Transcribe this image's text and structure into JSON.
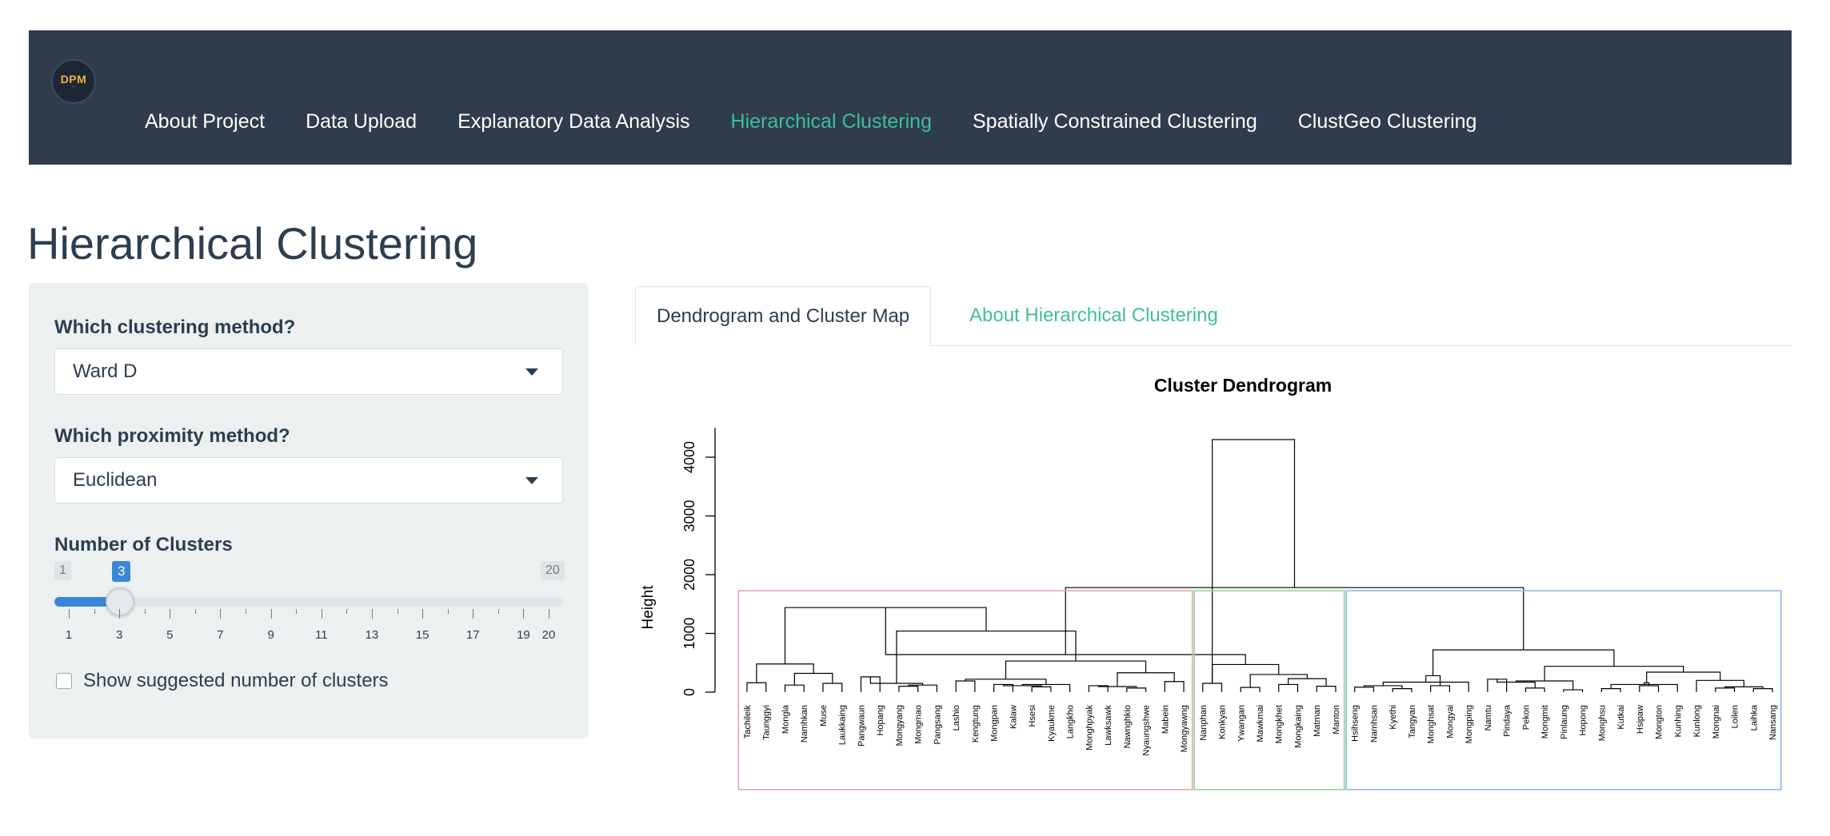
{
  "logo": {
    "text": "DPM"
  },
  "nav": {
    "items": [
      {
        "label": "About Project",
        "active": false
      },
      {
        "label": "Data Upload",
        "active": false
      },
      {
        "label": "Explanatory Data Analysis",
        "active": false
      },
      {
        "label": "Hierarchical Clustering",
        "active": true
      },
      {
        "label": "Spatially Constrained Clustering",
        "active": false
      },
      {
        "label": "ClustGeo Clustering",
        "active": false
      }
    ]
  },
  "page": {
    "title": "Hierarchical Clustering"
  },
  "sidebar": {
    "clustering_method": {
      "label": "Which clustering method?",
      "value": "Ward D"
    },
    "proximity_method": {
      "label": "Which proximity method?",
      "value": "Euclidean"
    },
    "clusters": {
      "label": "Number of Clusters",
      "min": 1,
      "max": 20,
      "value": 3,
      "min_label": "1",
      "max_label": "20",
      "value_label": "3",
      "tick_labels": [
        "1",
        "3",
        "5",
        "7",
        "9",
        "11",
        "13",
        "15",
        "17",
        "19",
        "20"
      ]
    },
    "suggest": {
      "label": "Show suggested number of clusters",
      "checked": false
    }
  },
  "tabs": [
    {
      "label": "Dendrogram and Cluster Map",
      "active": true
    },
    {
      "label": "About Hierarchical Clustering",
      "active": false
    }
  ],
  "colors": {
    "navbar": "#2f3c4d",
    "accent": "#3fbf99",
    "slider": "#3a87d6",
    "cluster_1": "#e8a3ad",
    "cluster_2": "#8fd68f",
    "cluster_3": "#8ab8e6"
  },
  "chart_data": {
    "type": "dendrogram",
    "title": "Cluster Dendrogram",
    "ylabel": "Height",
    "yticks": [
      0,
      1000,
      2000,
      3000,
      4000
    ],
    "ylim": [
      0,
      4300
    ],
    "leaves": [
      "Tachileik",
      "Taunggyi",
      "Mongla",
      "Namhkan",
      "Muse",
      "Laukkaing",
      "Pangwaun",
      "Hopang",
      "Mongyang",
      "Mongmao",
      "Pangsang",
      "Lashio",
      "Kengtung",
      "Mongpan",
      "Kalaw",
      "Hsesi",
      "Kyaukme",
      "Langkho",
      "Monghpyak",
      "Lawksawk",
      "Nawnghkio",
      "Nyaungshwe",
      "Mabein",
      "Mongyawng",
      "Nanphan",
      "Konkyan",
      "Ywangan",
      "Mawkmai",
      "Mongkhet",
      "Mongkaing",
      "Matman",
      "Manton",
      "Hsihseng",
      "Namhsan",
      "Kyethi",
      "Tangyan",
      "Monghsat",
      "Mongyai",
      "Mongping",
      "Namtu",
      "Pindaya",
      "Pekon",
      "Mongmit",
      "Pinlaung",
      "Hopong",
      "Monghsu",
      "Kutkai",
      "Hsipaw",
      "Mongton",
      "Kunhing",
      "Kunlong",
      "Mongnai",
      "Loilen",
      "Laihka",
      "Nansang"
    ],
    "merges": [
      [
        -1,
        -2,
        160
      ],
      [
        -3,
        -4,
        120
      ],
      [
        -5,
        -6,
        150
      ],
      [
        2,
        3,
        320
      ],
      [
        1,
        4,
        480
      ],
      [
        -7,
        -8,
        260
      ],
      [
        -9,
        -10,
        100
      ],
      [
        -11,
        7,
        120
      ],
      [
        6,
        8,
        150
      ],
      [
        -12,
        -13,
        190
      ],
      [
        -14,
        -15,
        130
      ],
      [
        -16,
        -17,
        90
      ],
      [
        11,
        12,
        110
      ],
      [
        -18,
        13,
        130
      ],
      [
        10,
        14,
        220
      ],
      [
        -19,
        -20,
        110
      ],
      [
        -21,
        -22,
        70
      ],
      [
        16,
        17,
        95
      ],
      [
        -23,
        -24,
        180
      ],
      [
        18,
        19,
        330
      ],
      [
        15,
        20,
        530
      ],
      [
        9,
        21,
        1040
      ],
      [
        5,
        22,
        1440
      ],
      [
        -25,
        -26,
        150
      ],
      [
        -27,
        -28,
        80
      ],
      [
        -29,
        -30,
        130
      ],
      [
        -31,
        -32,
        100
      ],
      [
        26,
        27,
        230
      ],
      [
        25,
        28,
        300
      ],
      [
        24,
        29,
        470
      ],
      [
        23,
        30,
        640
      ],
      [
        -33,
        -34,
        85
      ],
      [
        -35,
        -36,
        60
      ],
      [
        32,
        33,
        110
      ],
      [
        -37,
        -38,
        110
      ],
      [
        -39,
        34,
        170
      ],
      [
        35,
        36,
        280
      ],
      [
        -40,
        -41,
        220
      ],
      [
        -42,
        -43,
        70
      ],
      [
        -44,
        -45,
        40
      ],
      [
        38,
        39,
        170
      ],
      [
        40,
        41,
        190
      ],
      [
        -46,
        -47,
        60
      ],
      [
        -48,
        -49,
        110
      ],
      [
        -50,
        43,
        130
      ],
      [
        44,
        45,
        160
      ],
      [
        -52,
        -53,
        70
      ],
      [
        -54,
        -55,
        60
      ],
      [
        47,
        48,
        90
      ],
      [
        -51,
        49,
        200
      ],
      [
        46,
        50,
        340
      ],
      [
        42,
        51,
        440
      ],
      [
        37,
        52,
        720
      ],
      [
        31,
        53,
        1780
      ],
      [
        24,
        54,
        4300
      ]
    ],
    "cluster_groups": [
      {
        "id": 1,
        "start": 0,
        "end": 23,
        "color": "#e8a3ad"
      },
      {
        "id": 2,
        "start": 24,
        "end": 31,
        "color": "#8fd68f"
      },
      {
        "id": 3,
        "start": 32,
        "end": 54,
        "color": "#8ab8e6"
      }
    ]
  }
}
